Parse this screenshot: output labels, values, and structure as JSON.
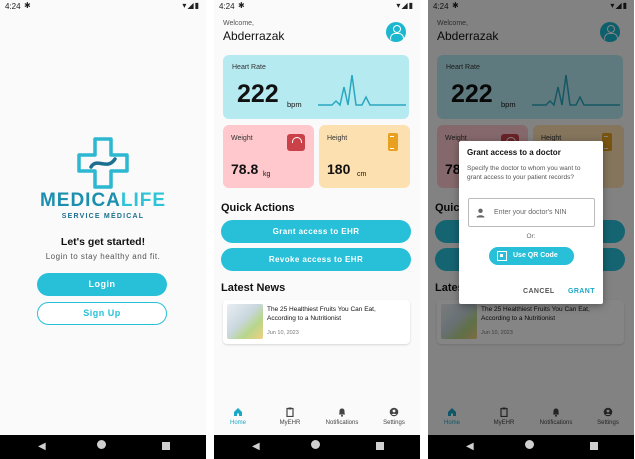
{
  "status_bar": {
    "time": "4:24"
  },
  "login_screen": {
    "brand_part1": "MEDICA",
    "brand_part2": "LIFE",
    "brand_subtitle": "SERVICE MÉDICAL",
    "headline": "Let's get started!",
    "subtitle": "Login to stay healthy and fit.",
    "login_label": "Login",
    "signup_label": "Sign Up"
  },
  "home_screen": {
    "welcome_label": "Welcome,",
    "username": "Abderrazak",
    "heart_rate": {
      "label": "Heart Rate",
      "value": "222",
      "unit": "bpm"
    },
    "weight": {
      "label": "Weight",
      "value": "78.8",
      "unit": "kg"
    },
    "height": {
      "label": "Height",
      "value": "180",
      "unit": "cm"
    },
    "quick_actions_title": "Quick Actions",
    "grant_access_label": "Grant access to EHR",
    "revoke_access_label": "Revoke access to EHR",
    "latest_news_title": "Latest News",
    "news": {
      "title": "The 25 Healthiest Fruits You Can Eat, According to a Nutritionist",
      "date": "Jun 10, 2023"
    },
    "bottom_nav": [
      {
        "label": "Home",
        "icon": "home-icon"
      },
      {
        "label": "MyEHR",
        "icon": "clipboard-icon"
      },
      {
        "label": "Notifications",
        "icon": "bell-icon"
      },
      {
        "label": "Settings",
        "icon": "settings-icon"
      }
    ]
  },
  "grant_dialog": {
    "title": "Grant access to a doctor",
    "description": "Specify the doctor to whom you want to grant access to your patient records?",
    "input_placeholder": "Enter your doctor's NIN",
    "or_label": "Or:",
    "qr_label": "Use QR Code",
    "cancel_label": "CANCEL",
    "grant_label": "GRANT"
  },
  "colors": {
    "accent": "#27c0d8",
    "heart_card": "#b6eaf1",
    "weight_card": "#ffc8cd",
    "height_card": "#fde0b0",
    "brand_dark": "#1d8fae"
  }
}
